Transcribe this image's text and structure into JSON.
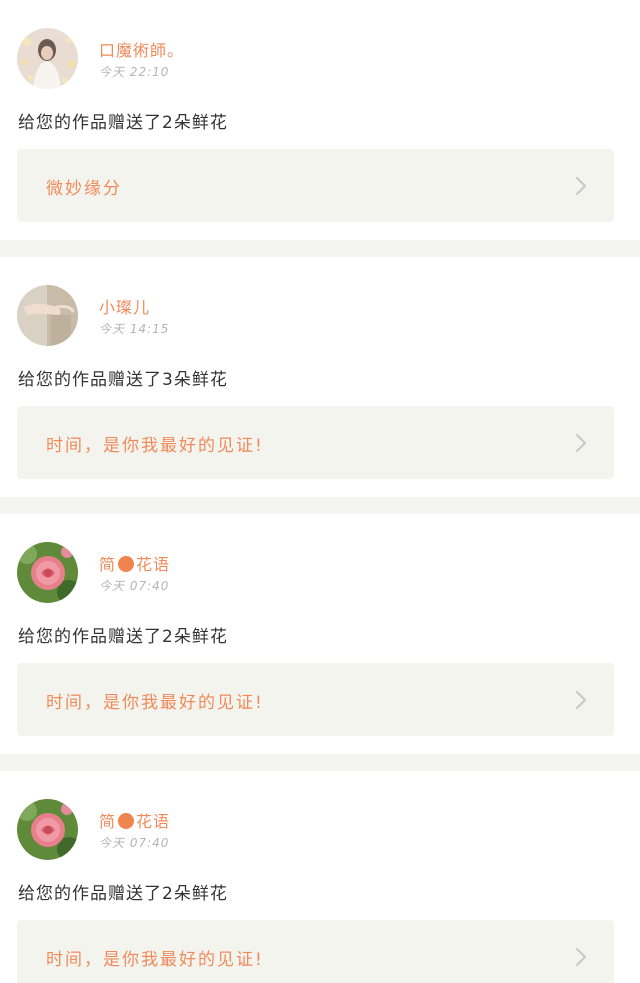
{
  "feed": {
    "items": [
      {
        "username": "口魔術師。",
        "time": "今天 22:10",
        "gift_text": "给您的作品赠送了2朵鲜花",
        "work_title": "微妙缘分",
        "avatar_icon": "woman-with-lights-avatar"
      },
      {
        "username": "小璨儿",
        "time": "今天 14:15",
        "gift_text": "给您的作品赠送了3朵鲜花",
        "work_title": "时间，是你我最好的见证!",
        "avatar_icon": "hand-avatar"
      },
      {
        "username_pre": "简",
        "username_post": "花语",
        "time": "今天 07:40",
        "gift_text": "给您的作品赠送了2朵鲜花",
        "work_title": "时间，是你我最好的见证!",
        "avatar_icon": "rose-avatar"
      },
      {
        "username_pre": "简",
        "username_post": "花语",
        "time": "今天 07:40",
        "gift_text": "给您的作品赠送了2朵鲜花",
        "work_title": "时间，是你我最好的见证!",
        "avatar_icon": "rose-avatar"
      }
    ]
  },
  "colors": {
    "accent": "#f08a5a",
    "text": "#333333",
    "muted": "#b5b5b5",
    "card_bg": "#f4f4ee",
    "separator": "#f4f4f2",
    "chevron": "#c8c8c8"
  },
  "icons": {
    "chevron": "chevron-right-icon",
    "name_dot": "orange-dot-icon"
  }
}
